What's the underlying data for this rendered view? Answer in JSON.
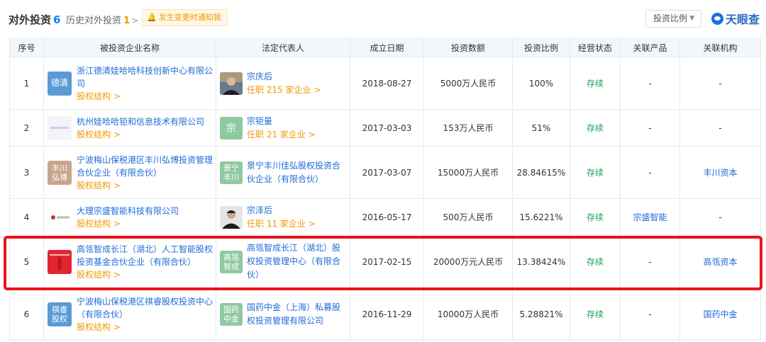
{
  "header": {
    "title": "对外投资",
    "title_count": "6",
    "history_label": "历史对外投资",
    "history_count": "1",
    "history_chevron": ">",
    "notify_label": "发生变更时通知我",
    "ratio_select": "投资比例",
    "brand": "天眼查"
  },
  "table": {
    "columns": [
      "序号",
      "被投资企业名称",
      "法定代表人",
      "成立日期",
      "投资数额",
      "投资比例",
      "经营状态",
      "关联产品",
      "关联机构"
    ],
    "rows": [
      {
        "index": "1",
        "logo_text": "德清",
        "logo_color": "#5b9bd5",
        "company": "浙江德清娃哈哈科技创新中心有限公司",
        "equity_link": "股权结构 >",
        "legal_avatar_text": "",
        "legal_name": "宗庆后",
        "legal_title": "任职 215 家企业 >",
        "date": "2018-08-27",
        "amount": "5000万人民币",
        "ratio": "100%",
        "status": "存续",
        "product": "-",
        "org": "-"
      },
      {
        "index": "2",
        "logo_text": "",
        "logo_color": "#f4f4f8",
        "company": "杭州娃哈哈钜和信息技术有限公司",
        "equity_link": "股权结构 >",
        "legal_avatar_text": "宗",
        "legal_name": "宗钜量",
        "legal_title": "任职 21 家企业 >",
        "date": "2017-03-03",
        "amount": "153万人民币",
        "ratio": "51%",
        "status": "存续",
        "product": "-",
        "org": "-"
      },
      {
        "index": "3",
        "logo_text": "丰川弘博",
        "logo_color": "#c9a48c",
        "company": "宁波梅山保税港区丰川弘博投资管理合伙企业（有限合伙）",
        "equity_link": "股权结构 >",
        "legal_avatar_text": "景宁丰川",
        "legal_name": "景宁丰川佳弘股权投资合伙企业（有限合伙）",
        "legal_title": "",
        "date": "2017-03-07",
        "amount": "15000万人民币",
        "ratio": "28.84615%",
        "status": "存续",
        "product": "-",
        "org": "丰川资本"
      },
      {
        "index": "4",
        "logo_text": "",
        "logo_color": "#ffffff",
        "company": "大理宗盛智能科技有限公司",
        "equity_link": "股权结构 >",
        "legal_avatar_text": "",
        "legal_name": "宗泽后",
        "legal_title": "任职 11 家企业 >",
        "date": "2016-05-17",
        "amount": "500万人民币",
        "ratio": "15.6221%",
        "status": "存续",
        "product": "宗盛智能",
        "org": "-"
      },
      {
        "index": "5",
        "logo_text": "",
        "logo_color": "#e3262e",
        "company": "高瓴智成长江（湖北）人工智能股权投资基金合伙企业（有限合伙）",
        "equity_link": "股权结构 >",
        "legal_avatar_text": "高瓴智成",
        "legal_name": "高瓴智成长江（湖北）股权投资管理中心（有限合伙）",
        "legal_title": "",
        "date": "2017-02-15",
        "amount": "20000万元人民币",
        "ratio": "13.38424%",
        "status": "存续",
        "product": "-",
        "org": "高瓴资本"
      },
      {
        "index": "6",
        "logo_text": "祺睿股权",
        "logo_color": "#5b9bd5",
        "company": "宁波梅山保税港区祺睿股权投资中心（有限合伙）",
        "equity_link": "股权结构 >",
        "legal_avatar_text": "国药中金",
        "legal_name": "国药中金（上海）私募股权投资管理有限公司",
        "legal_title": "",
        "date": "2016-11-29",
        "amount": "10000万人民币",
        "ratio": "5.28821%",
        "status": "存续",
        "product": "-",
        "org": "国药中金"
      }
    ]
  },
  "colors": {
    "link": "#1e6bd6",
    "accent_orange": "#f39800",
    "status_green": "#18a058",
    "highlight_red": "#e8141c",
    "header_bg": "#f2f7fc"
  }
}
